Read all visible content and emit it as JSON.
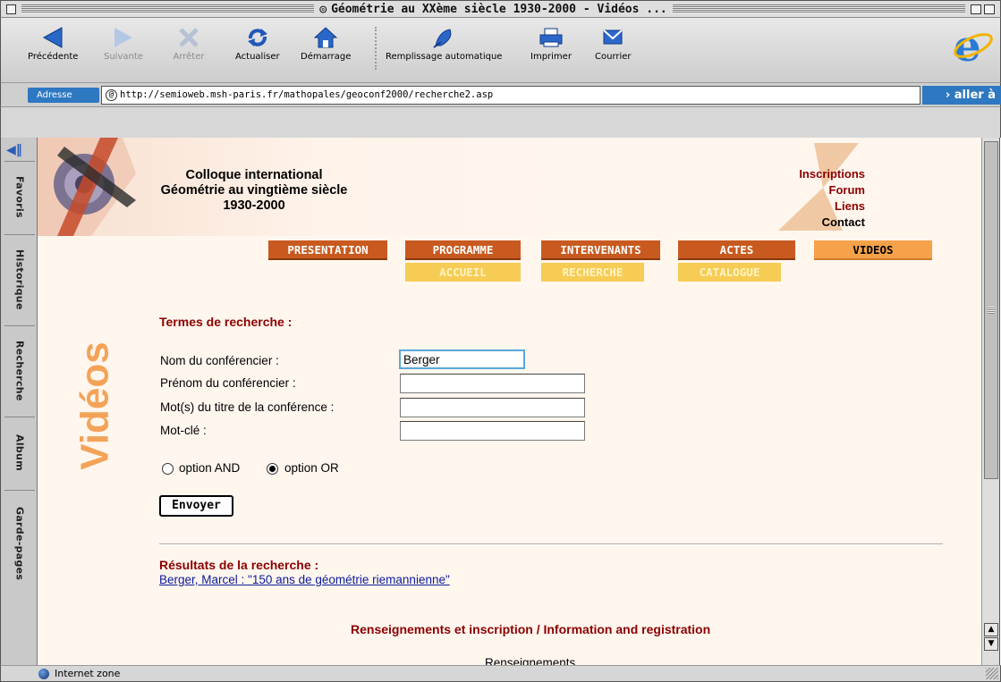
{
  "window": {
    "title": "Géométrie au XXème siècle 1930-2000 - Vidéos ..."
  },
  "toolbar": {
    "back": "Précédente",
    "forward": "Suivante",
    "stop": "Arrêter",
    "refresh": "Actualiser",
    "home": "Démarrage",
    "autofill": "Remplissage automatique",
    "print": "Imprimer",
    "mail": "Courrier"
  },
  "address": {
    "label": "Adresse",
    "url": "http://semioweb.msh-paris.fr/mathopales/geoconf2000/recherche2.asp",
    "go": "aller à"
  },
  "sidebar": {
    "tabs": [
      "Favoris",
      "Historique",
      "Recherche",
      "Album",
      "Garde-pages"
    ]
  },
  "header": {
    "line1": "Colloque international",
    "line2": "Géométrie au vingtième siècle",
    "line3": "1930-2000",
    "links": [
      "Inscriptions",
      "Forum",
      "Liens",
      "Contact"
    ]
  },
  "nav": {
    "main": [
      "PRESENTATION",
      "PROGRAMME",
      "INTERVENANTS",
      "ACTES",
      "VIDEOS"
    ],
    "sub": [
      "ACCUEIL",
      "RECHERCHE",
      "CATALOGUE"
    ]
  },
  "page": {
    "section_heading": "Vidéos"
  },
  "form": {
    "heading": "Termes de recherche :",
    "labels": {
      "last_name": "Nom du conférencier :",
      "first_name": "Prénom du conférencier :",
      "title_words": "Mot(s) du titre de la conférence :",
      "keyword": "Mot-clé :"
    },
    "values": {
      "last_name": "Berger",
      "first_name": "",
      "title_words": "",
      "keyword": ""
    },
    "option_and": "option AND",
    "option_or": "option OR",
    "selected_option": "OR",
    "submit": "Envoyer"
  },
  "results": {
    "heading": "Résultats de la recherche :",
    "items": [
      "Berger, Marcel : \"150 ans de géométrie riemannienne\""
    ]
  },
  "footer": {
    "title": "Renseignements et inscription / Information and registration",
    "cut_text": "Renseignements"
  },
  "status": {
    "zone": "Internet zone"
  },
  "colors": {
    "accent_orange": "#c85a1f",
    "active_tab": "#f6a24a",
    "subnav_yellow": "#f7cc55",
    "dark_red": "#8b0000",
    "videos_orange": "#f3a357",
    "link_blue": "#0b1a9a",
    "ie_blue": "#2e78c2"
  }
}
